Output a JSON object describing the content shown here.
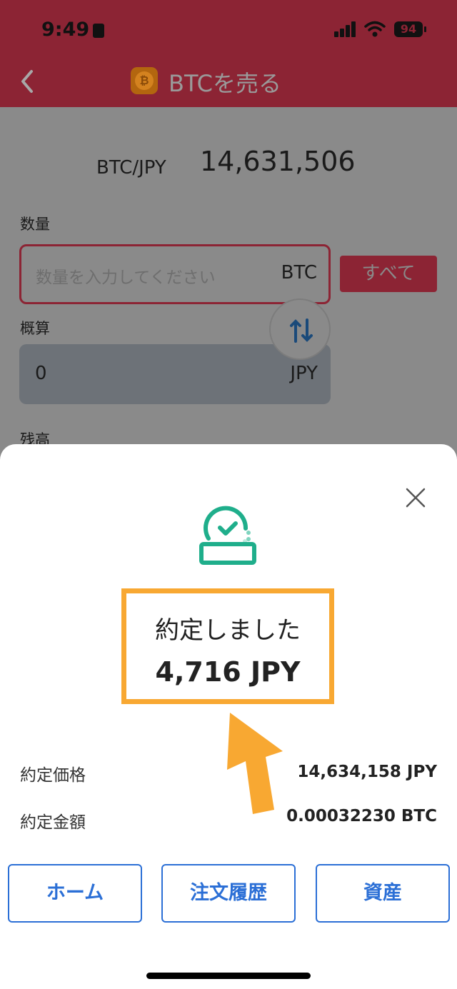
{
  "status_bar": {
    "time": "9:49",
    "battery": "94"
  },
  "header": {
    "title": "BTCを売る",
    "coin_symbol": "₿"
  },
  "ticker": {
    "pair": "BTC/JPY",
    "price": "14,631,506"
  },
  "form": {
    "quantity_label": "数量",
    "quantity_placeholder": "数量を入力してください",
    "quantity_unit": "BTC",
    "all_button": "すべて",
    "estimate_label": "概算",
    "estimate_value": "0",
    "estimate_unit": "JPY",
    "balance_label": "残高"
  },
  "result": {
    "message": "約定しました",
    "amount": "4,716 JPY",
    "rows": [
      {
        "label": "約定価格",
        "value": "14,634,158 JPY"
      },
      {
        "label": "約定金額",
        "value": "0.00032230 BTC"
      }
    ],
    "buttons": {
      "home": "ホーム",
      "history": "注文履歴",
      "assets": "資産"
    }
  },
  "colors": {
    "brand": "#c8344f",
    "success": "#1fae8b",
    "highlight": "#f8a832",
    "link": "#2b6fd6"
  },
  "icons": [
    "back-chevron-icon",
    "bitcoin-icon",
    "swap-icon",
    "close-icon",
    "check-circle-icon",
    "arrow-up-icon"
  ]
}
